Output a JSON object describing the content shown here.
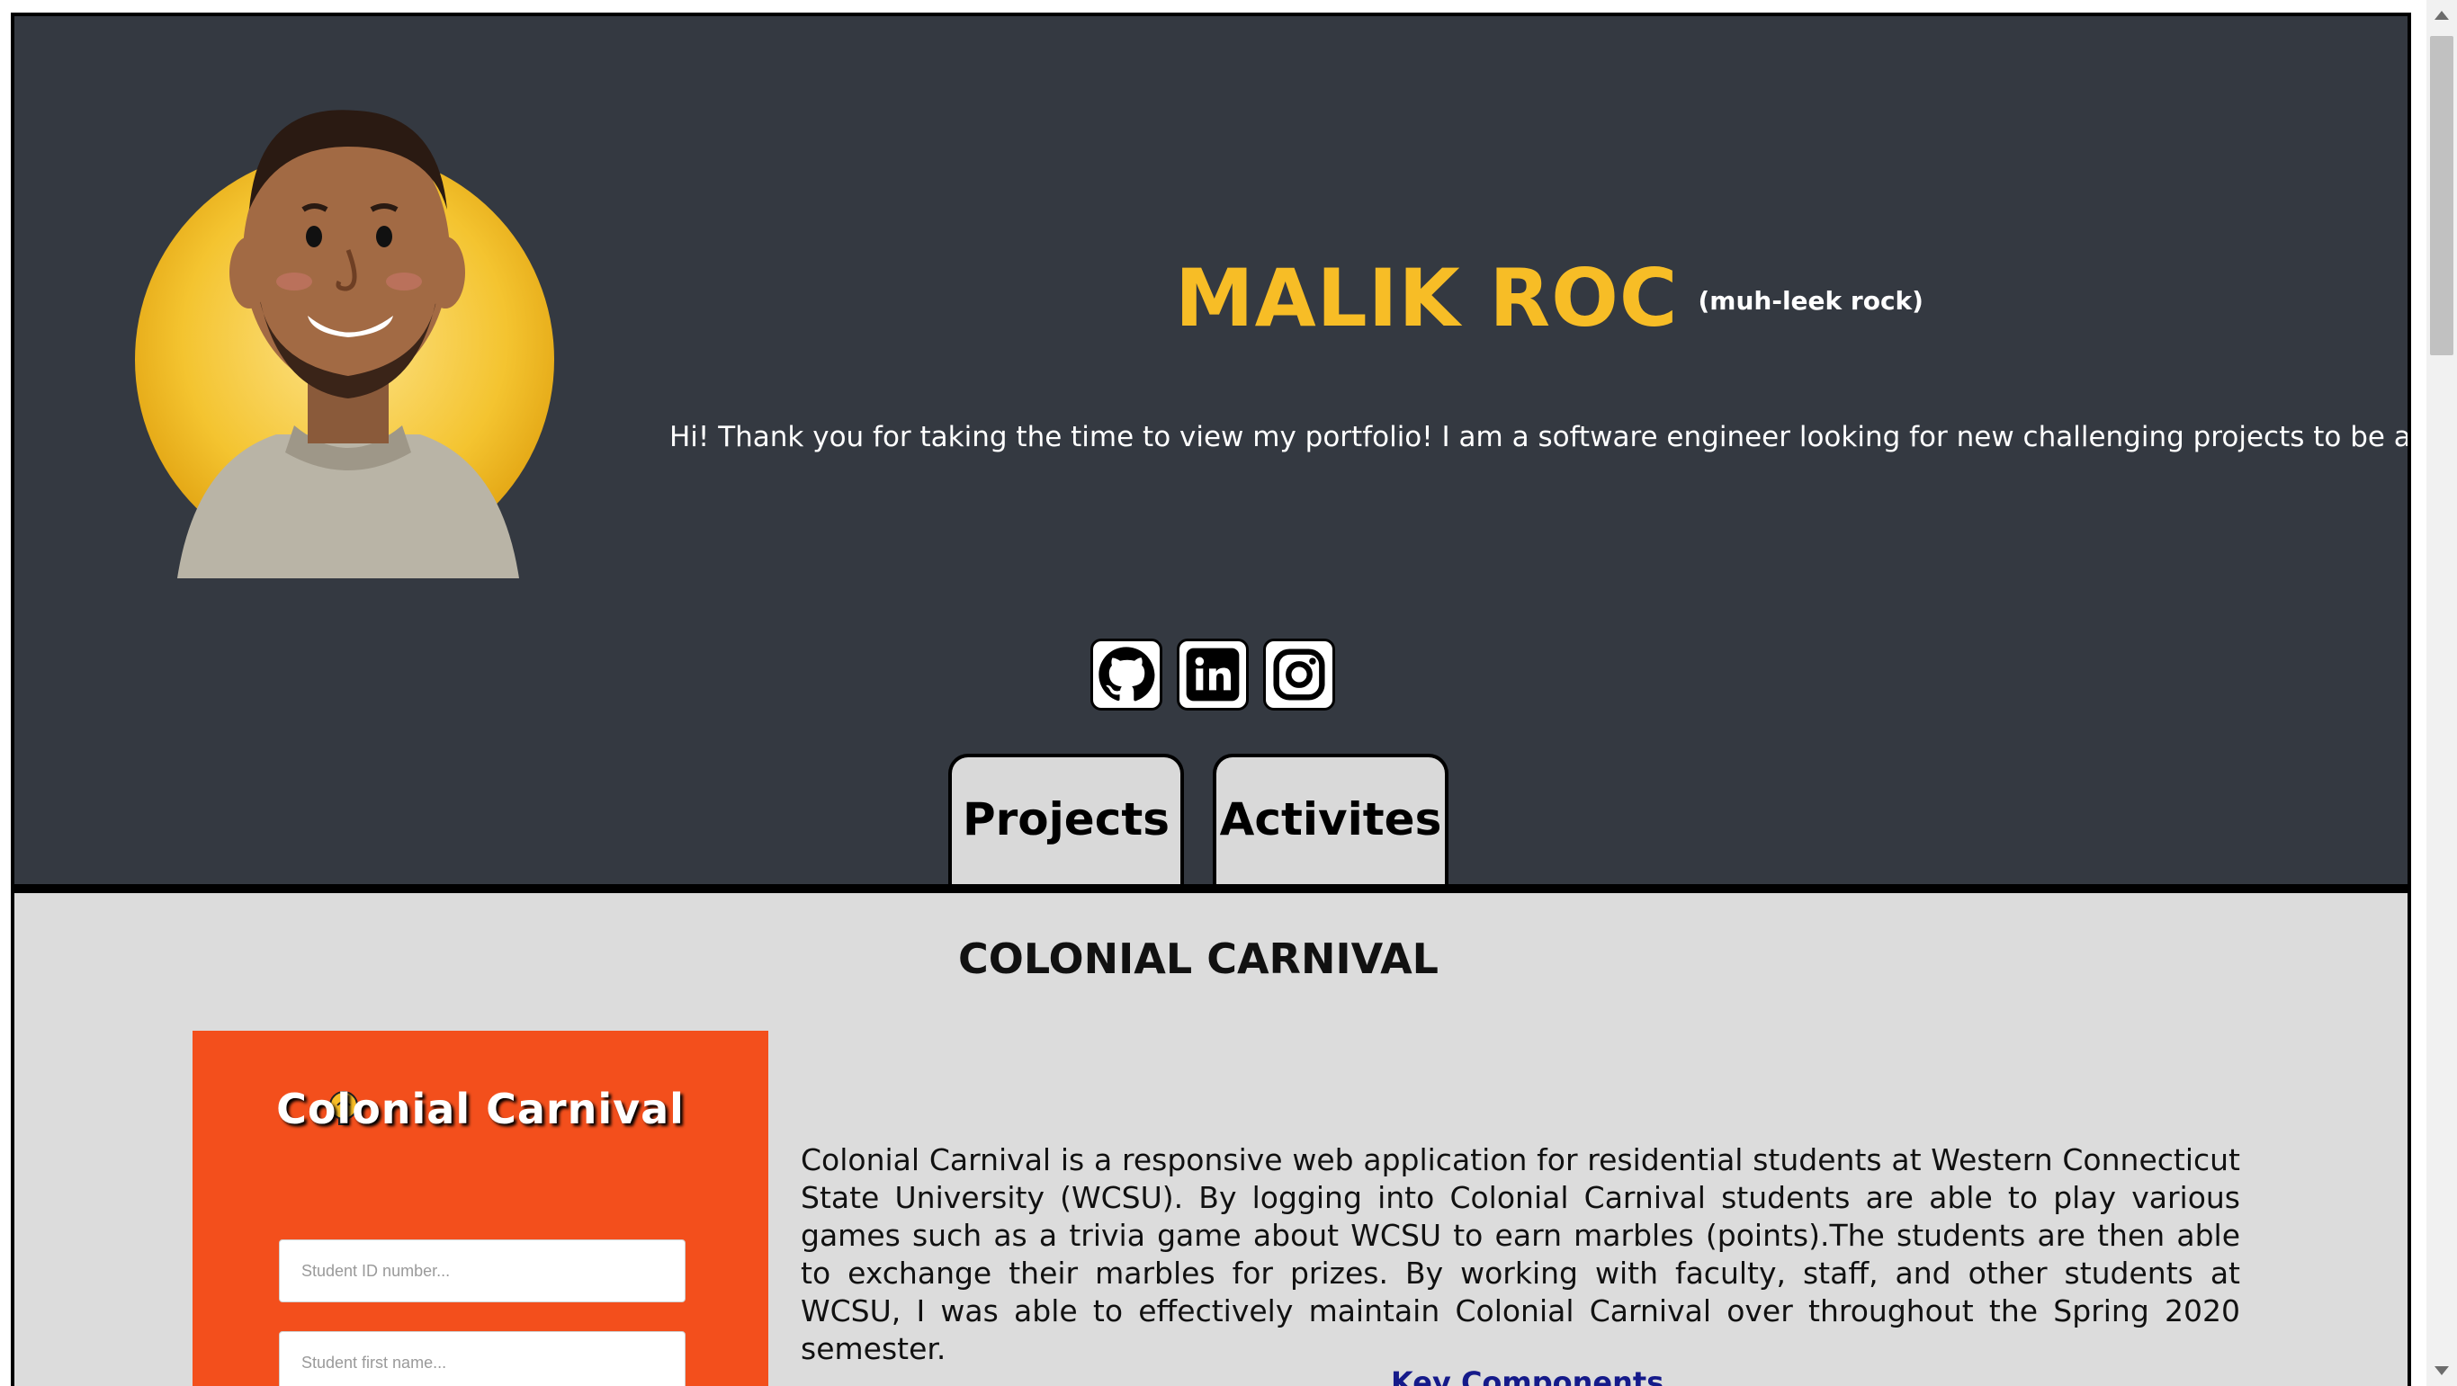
{
  "profile": {
    "name": "MALIK ROC",
    "pronunciation": "(muh-leek rock)",
    "intro": "Hi! Thank you for taking the time to view my portfolio! I am a software engineer looking for new challenging projects to be a part of."
  },
  "socials": [
    {
      "icon": "github-icon"
    },
    {
      "icon": "linkedin-icon"
    },
    {
      "icon": "instagram-icon"
    }
  ],
  "tabs": [
    {
      "label": "Projects"
    },
    {
      "label": "Activites"
    }
  ],
  "project": {
    "title": "COLONIAL CARNIVAL",
    "app_logo_text": "Colonial Carnival",
    "fields": [
      {
        "placeholder": "Student ID number..."
      },
      {
        "placeholder": "Student first name..."
      }
    ],
    "description": "Colonial Carnival is a responsive web application for residential students at Western Connecticut State University (WCSU). By logging into Colonial Carnival students are able to play various games such as a trivia game about WCSU to earn marbles (points).The students are then able to exchange their marbles for prizes. By working with faculty, staff, and other students at WCSU, I was able to effectively maintain Colonial Carnival over throughout the Spring 2020 semester.",
    "key_components_label": "Key Components"
  },
  "colors": {
    "header_bg": "#343941",
    "name_accent": "#f7bd26",
    "content_bg": "#dcdcdc",
    "project_shot_bg": "#f34f1c",
    "link": "#151a8a"
  }
}
